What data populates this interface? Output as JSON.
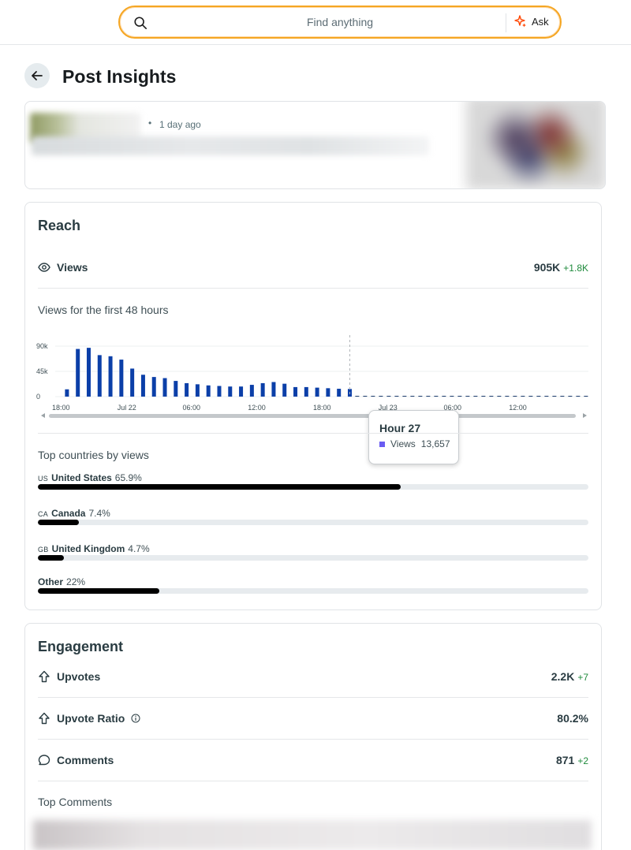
{
  "search": {
    "placeholder": "Find anything",
    "ask_label": "Ask"
  },
  "header": {
    "title": "Post Insights"
  },
  "post": {
    "time": "1 day ago",
    "separator": "•"
  },
  "reach": {
    "title": "Reach",
    "views_label": "Views",
    "views_value": "905K",
    "views_delta": "+1.8K",
    "chart_label": "Views for the first 48 hours",
    "countries_label": "Top countries by views",
    "countries": [
      {
        "code": "US",
        "name": "United States",
        "pct": "65.9%",
        "fraction": 0.659
      },
      {
        "code": "CA",
        "name": "Canada",
        "pct": "7.4%",
        "fraction": 0.074
      },
      {
        "code": "GB",
        "name": "United Kingdom",
        "pct": "4.7%",
        "fraction": 0.047
      },
      {
        "code": "",
        "name": "Other",
        "pct": "22%",
        "fraction": 0.22
      }
    ],
    "tooltip": {
      "title": "Hour 27",
      "series": "Views",
      "value": "13,657"
    }
  },
  "engagement": {
    "title": "Engagement",
    "upvotes_label": "Upvotes",
    "upvotes_value": "2.2K",
    "upvotes_delta": "+7",
    "ratio_label": "Upvote Ratio",
    "ratio_value": "80.2%",
    "comments_label": "Comments",
    "comments_value": "871",
    "comments_delta": "+2",
    "top_comments_label": "Top Comments"
  },
  "colors": {
    "bar": "#0b3fa8",
    "accent": "#f5a623",
    "positive": "#1f8a3c"
  },
  "chart_data": {
    "type": "bar",
    "x_tick_labels": [
      "18:00",
      "Jul 22",
      "06:00",
      "12:00",
      "18:00",
      "Jul 23",
      "06:00",
      "12:00"
    ],
    "y_tick_labels": [
      "0",
      "45k",
      "90k"
    ],
    "ylim": [
      0,
      90000
    ],
    "values": [
      13000,
      85000,
      87000,
      74000,
      72000,
      66000,
      50000,
      39000,
      35000,
      33000,
      28000,
      24000,
      22000,
      20000,
      19000,
      18000,
      18000,
      21000,
      24000,
      26000,
      23000,
      17000,
      17000,
      16000,
      15000,
      14000,
      13657
    ],
    "highlighted_hour": 27
  }
}
